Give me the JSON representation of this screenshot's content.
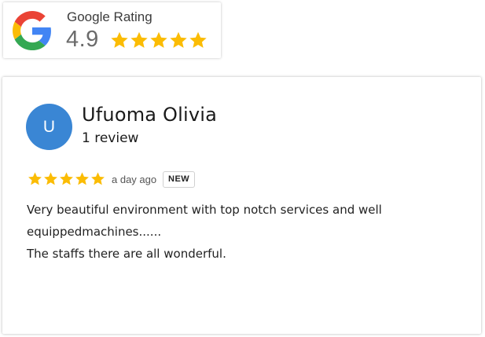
{
  "badge": {
    "title": "Google Rating",
    "score": "4.9",
    "stars": 5,
    "star_color": "#fbbc04"
  },
  "review": {
    "avatar_letter": "U",
    "avatar_color": "#3a86d4",
    "name": "Ufuoma Olivia",
    "review_count": "1 review",
    "stars": 5,
    "time": "a day ago",
    "new_label": "NEW",
    "text_lines": [
      "Very beautiful environment with top notch services and well equippedmachines......",
      "The staffs there are all wonderful."
    ]
  },
  "icons": {
    "logo": "google-g-icon",
    "star": "star-icon"
  }
}
